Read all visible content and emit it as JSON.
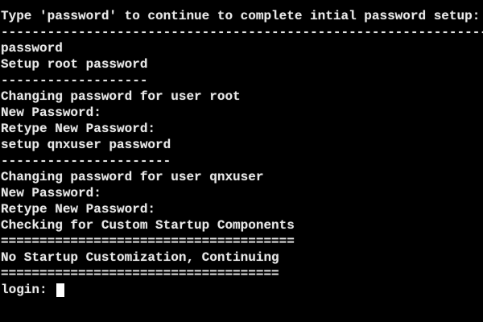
{
  "terminal": {
    "lines": [
      "Type 'password' to continue to complete intial password setup:",
      "---------------------------------------------------------------",
      "password",
      "Setup root password",
      "-------------------",
      "Changing password for user root",
      "New Password:",
      "Retype New Password:",
      "setup qnxuser password",
      "----------------------",
      "Changing password for user qnxuser",
      "New Password:",
      "Retype New Password:",
      "Checking for Custom Startup Components",
      "======================================",
      "No Startup Customization, Continuing",
      "===================================="
    ],
    "prompt": "login: "
  },
  "colors": {
    "background": "#000000",
    "text": "#e8e8e8",
    "cursor": "#ffffff"
  }
}
